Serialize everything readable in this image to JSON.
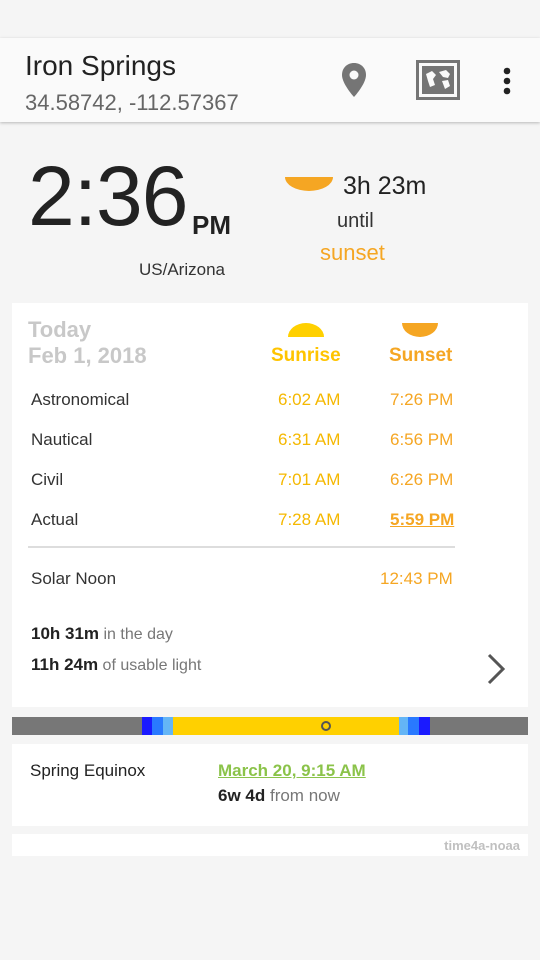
{
  "appbar": {
    "title": "Iron Springs",
    "coords": "34.58742, -112.57367",
    "icons": [
      "location-pin-icon",
      "map-icon",
      "more-vert-icon"
    ]
  },
  "hero": {
    "time": "2:36",
    "ampm": "PM",
    "timezone": "US/Arizona",
    "until_time": "3h 23m",
    "until_word": "until",
    "until_event": "sunset"
  },
  "table": {
    "today": "Today",
    "date": "Feb 1, 2018",
    "sunrise_label": "Sunrise",
    "sunset_label": "Sunset",
    "rows": [
      {
        "label": "Astronomical",
        "rise": "6:02 AM",
        "set": "7:26 PM"
      },
      {
        "label": "Nautical",
        "rise": "6:31 AM",
        "set": "6:56 PM"
      },
      {
        "label": "Civil",
        "rise": "7:01 AM",
        "set": "6:26 PM"
      },
      {
        "label": "Actual",
        "rise": "7:28 AM",
        "set": "5:59 PM"
      }
    ],
    "noon_label": "Solar Noon",
    "noon_time": "12:43 PM",
    "day_length": "10h 31m",
    "day_length_suffix": " in the day",
    "usable_light": "11h 24m",
    "usable_light_suffix": " of usable light"
  },
  "colors": {
    "sunrise": "#f5b800",
    "sunset": "#f5a623",
    "day": "#ffd000",
    "night": "#777777",
    "astronomical": "#1a1aff",
    "nautical": "#2979ff",
    "civil": "#64b5f6",
    "equinox_link": "#8bc34a"
  },
  "equinox": {
    "label": "Spring Equinox",
    "date": "March 20, 9:15 AM",
    "relative_bold": "6w 4d",
    "relative_suffix": " from now"
  },
  "footer": {
    "brand": "time4a-noaa"
  }
}
